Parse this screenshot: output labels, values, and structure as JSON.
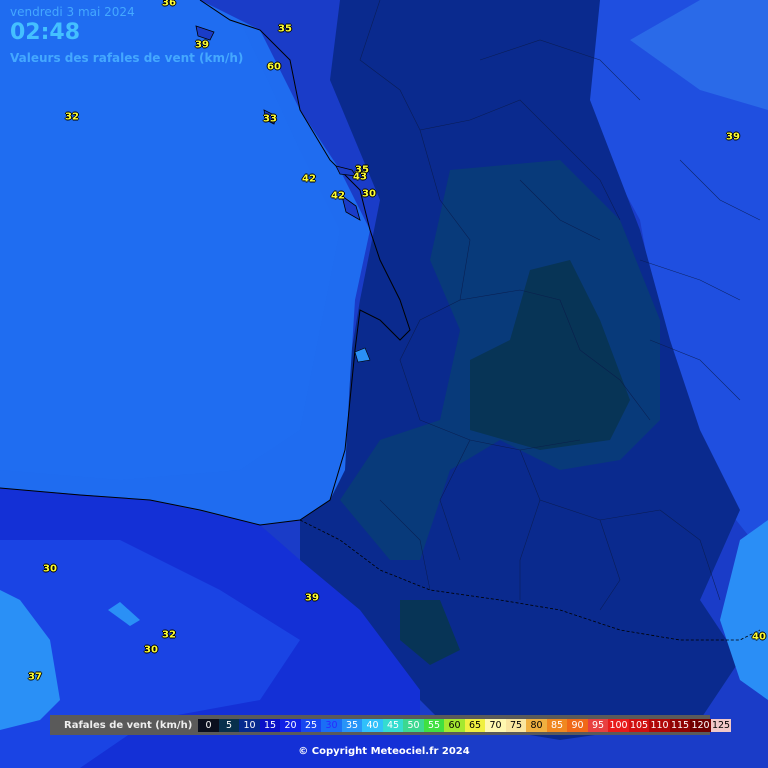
{
  "header": {
    "date": "vendredi 3 mai 2024",
    "time": "02:48",
    "subtitle": "Valeurs des rafales de vent (km/h)"
  },
  "labels": [
    {
      "text": "36",
      "color": "#ffff33"
    },
    {
      "text": "35",
      "color": "#ffff33"
    },
    {
      "text": "39",
      "color": "#ffff33"
    },
    {
      "text": "60",
      "color": "#ffff33"
    },
    {
      "text": "32",
      "color": "#ffff33"
    },
    {
      "text": "33",
      "color": "#ffff33"
    },
    {
      "text": "39",
      "color": "#ffff33"
    },
    {
      "text": "35",
      "color": "#ffff33"
    },
    {
      "text": "43",
      "color": "#ffff33"
    },
    {
      "text": "42",
      "color": "#ffff33"
    },
    {
      "text": "42",
      "color": "#ffff33"
    },
    {
      "text": "30",
      "color": "#ffff33"
    },
    {
      "text": "30",
      "color": "#ffff33"
    },
    {
      "text": "39",
      "color": "#ffff33"
    },
    {
      "text": "32",
      "color": "#ffff33"
    },
    {
      "text": "30",
      "color": "#ffff33"
    },
    {
      "text": "37",
      "color": "#ffff33"
    },
    {
      "text": "40",
      "color": "#ffff33"
    }
  ],
  "legend": {
    "title": "Rafales de vent (km/h)",
    "steps": [
      {
        "value": "0",
        "bg": "#0a0f1e",
        "fg": "#ffffff"
      },
      {
        "value": "5",
        "bg": "#08304c",
        "fg": "#ffffff"
      },
      {
        "value": "10",
        "bg": "#062a8e",
        "fg": "#ffffff"
      },
      {
        "value": "15",
        "bg": "#0a10c8",
        "fg": "#ffffff"
      },
      {
        "value": "20",
        "bg": "#1020e6",
        "fg": "#ffffff"
      },
      {
        "value": "25",
        "bg": "#1846f0",
        "fg": "#ffffff"
      },
      {
        "value": "30",
        "bg": "#1a6ef6",
        "fg": "#2a2aff"
      },
      {
        "value": "35",
        "bg": "#2894f8",
        "fg": "#ffffff"
      },
      {
        "value": "40",
        "bg": "#30c0fa",
        "fg": "#ffffff"
      },
      {
        "value": "45",
        "bg": "#34dcd0",
        "fg": "#ffffff"
      },
      {
        "value": "50",
        "bg": "#3cd890",
        "fg": "#ffffff"
      },
      {
        "value": "55",
        "bg": "#40e040",
        "fg": "#ffffff"
      },
      {
        "value": "60",
        "bg": "#a4e830",
        "fg": "#000000"
      },
      {
        "value": "65",
        "bg": "#f0f040",
        "fg": "#000000"
      },
      {
        "value": "70",
        "bg": "#fff8b0",
        "fg": "#000000"
      },
      {
        "value": "75",
        "bg": "#fae6a0",
        "fg": "#000000"
      },
      {
        "value": "80",
        "bg": "#f0b040",
        "fg": "#000000"
      },
      {
        "value": "85",
        "bg": "#f08820",
        "fg": "#ffffff"
      },
      {
        "value": "90",
        "bg": "#f06818",
        "fg": "#ffffff"
      },
      {
        "value": "95",
        "bg": "#e84040",
        "fg": "#ffffff"
      },
      {
        "value": "100",
        "bg": "#e81a1a",
        "fg": "#ffffff"
      },
      {
        "value": "105",
        "bg": "#d01010",
        "fg": "#ffffff"
      },
      {
        "value": "110",
        "bg": "#b00808",
        "fg": "#ffffff"
      },
      {
        "value": "115",
        "bg": "#900404",
        "fg": "#ffffff"
      },
      {
        "value": "120",
        "bg": "#700000",
        "fg": "#ffffff"
      },
      {
        "value": "125",
        "bg": "#f0c8c8",
        "fg": "#000000"
      }
    ]
  },
  "copyright": "© Copyright Meteociel.fr 2024"
}
